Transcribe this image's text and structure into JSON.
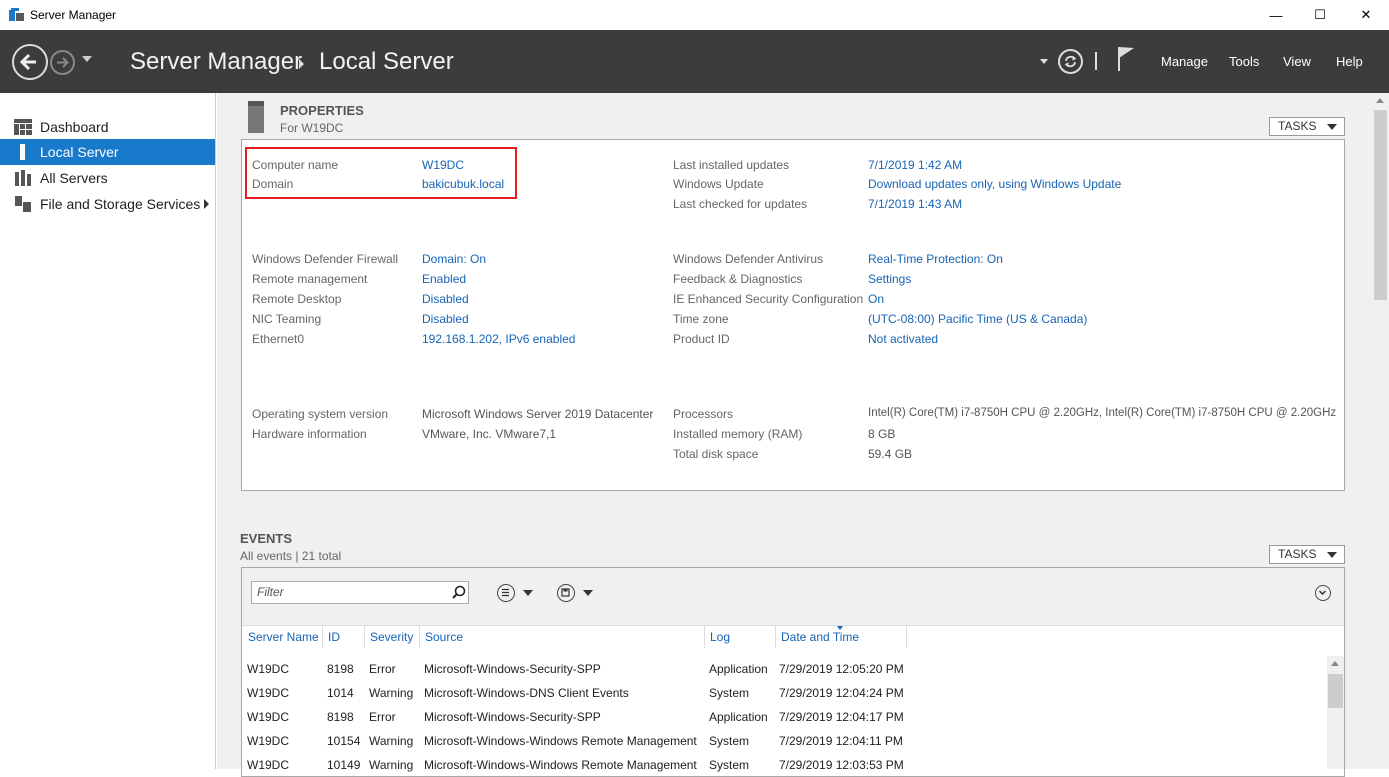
{
  "window": {
    "title": "Server Manager",
    "minimize_glyph": "—",
    "maximize_glyph": "☐",
    "close_glyph": "✕"
  },
  "header": {
    "breadcrumb_root": "Server Manager",
    "breadcrumb_current": "Local Server",
    "menu": [
      "Manage",
      "Tools",
      "View",
      "Help"
    ]
  },
  "sidebar": {
    "items": [
      {
        "label": "Dashboard",
        "icon": "dashboard-icon",
        "active": false
      },
      {
        "label": "Local Server",
        "icon": "server-icon",
        "active": true
      },
      {
        "label": "All Servers",
        "icon": "servers-icon",
        "active": false
      },
      {
        "label": "File and Storage Services",
        "icon": "storage-icon",
        "active": false,
        "expandable": true
      }
    ]
  },
  "properties": {
    "title": "PROPERTIES",
    "subtitle": "For W19DC",
    "tasks_label": "TASKS",
    "left_group_1": [
      {
        "label": "Computer name",
        "value": "W19DC"
      },
      {
        "label": "Domain",
        "value": "bakicubuk.local"
      }
    ],
    "right_group_1": [
      {
        "label": "Last installed updates",
        "value": "7/1/2019 1:42 AM"
      },
      {
        "label": "Windows Update",
        "value": "Download updates only, using Windows Update"
      },
      {
        "label": "Last checked for updates",
        "value": "7/1/2019 1:43 AM"
      }
    ],
    "left_group_2": [
      {
        "label": "Windows Defender Firewall",
        "value": "Domain: On"
      },
      {
        "label": "Remote management",
        "value": "Enabled"
      },
      {
        "label": "Remote Desktop",
        "value": "Disabled"
      },
      {
        "label": "NIC Teaming",
        "value": "Disabled"
      },
      {
        "label": "Ethernet0",
        "value": "192.168.1.202, IPv6 enabled"
      }
    ],
    "right_group_2": [
      {
        "label": "Windows Defender Antivirus",
        "value": "Real-Time Protection: On"
      },
      {
        "label": "Feedback & Diagnostics",
        "value": "Settings"
      },
      {
        "label": "IE Enhanced Security Configuration",
        "value": "On"
      },
      {
        "label": "Time zone",
        "value": "(UTC-08:00) Pacific Time (US & Canada)"
      },
      {
        "label": "Product ID",
        "value": "Not activated"
      }
    ],
    "left_group_3": [
      {
        "label": "Operating system version",
        "value": "Microsoft Windows Server 2019 Datacenter"
      },
      {
        "label": "Hardware information",
        "value": "VMware, Inc. VMware7,1"
      }
    ],
    "right_group_3": [
      {
        "label": "Processors",
        "value": "Intel(R) Core(TM) i7-8750H CPU @ 2.20GHz, Intel(R) Core(TM) i7-8750H CPU @ 2.20GHz"
      },
      {
        "label": "Installed memory (RAM)",
        "value": "8 GB"
      },
      {
        "label": "Total disk space",
        "value": "59.4 GB"
      }
    ]
  },
  "events": {
    "title": "EVENTS",
    "subtitle": "All events | 21 total",
    "tasks_label": "TASKS",
    "filter_placeholder": "Filter",
    "columns": [
      "Server Name",
      "ID",
      "Severity",
      "Source",
      "Log",
      "Date and Time"
    ],
    "rows": [
      [
        "W19DC",
        "8198",
        "Error",
        "Microsoft-Windows-Security-SPP",
        "Application",
        "7/29/2019 12:05:20 PM"
      ],
      [
        "W19DC",
        "1014",
        "Warning",
        "Microsoft-Windows-DNS Client Events",
        "System",
        "7/29/2019 12:04:24 PM"
      ],
      [
        "W19DC",
        "8198",
        "Error",
        "Microsoft-Windows-Security-SPP",
        "Application",
        "7/29/2019 12:04:17 PM"
      ],
      [
        "W19DC",
        "10154",
        "Warning",
        "Microsoft-Windows-Windows Remote Management",
        "System",
        "7/29/2019 12:04:11 PM"
      ],
      [
        "W19DC",
        "10149",
        "Warning",
        "Microsoft-Windows-Windows Remote Management",
        "System",
        "7/29/2019 12:03:53 PM"
      ]
    ]
  }
}
